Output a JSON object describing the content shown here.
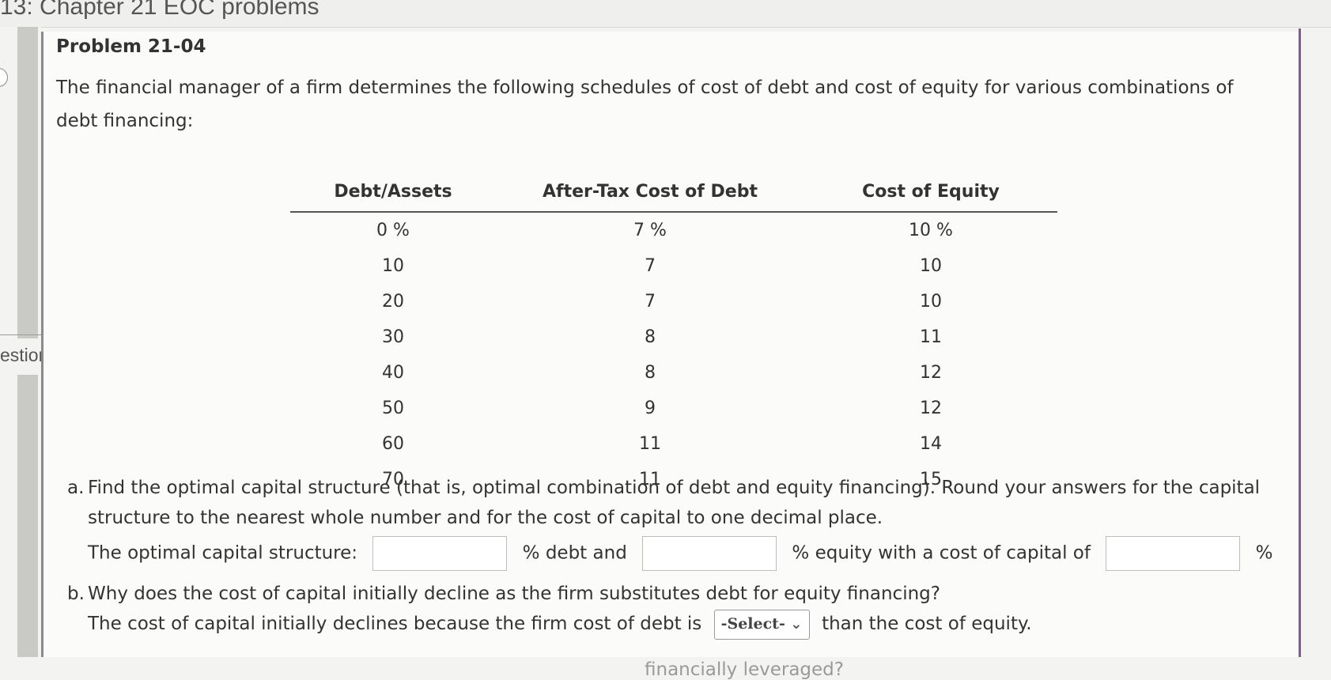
{
  "assignment": {
    "title": "13: Chapter 21 EOC problems"
  },
  "nav": {
    "label": "estions Navigation Menu"
  },
  "problem": {
    "title": "Problem 21-04",
    "intro": "The financial manager of a firm determines the following schedules of cost of debt and cost of equity for various combinations of debt financing:"
  },
  "schedule": {
    "headers": [
      "Debt/Assets",
      "After-Tax Cost of Debt",
      "Cost of Equity"
    ],
    "rows": [
      [
        "0 %",
        "7 %",
        "10 %"
      ],
      [
        "10",
        "7",
        "10"
      ],
      [
        "20",
        "7",
        "10"
      ],
      [
        "30",
        "8",
        "11"
      ],
      [
        "40",
        "8",
        "12"
      ],
      [
        "50",
        "9",
        "12"
      ],
      [
        "60",
        "11",
        "14"
      ],
      [
        "70",
        "11",
        "15"
      ]
    ]
  },
  "part_a": {
    "marker": "a.",
    "question_line1": "Find the optimal capital structure (that is, optimal combination of debt and equity financing). Round your answers for the capital",
    "question_line2": "structure to the nearest whole number and for the cost of capital to one decimal place.",
    "answer_label": "The optimal capital structure:",
    "debt_suffix": "% debt and",
    "equity_suffix": "% equity with a cost of capital of",
    "percent": "%"
  },
  "part_b": {
    "marker": "b.",
    "question": "Why does the cost of capital initially decline as the firm substitutes debt for equity financing?",
    "answer_prefix": "The cost of capital initially declines because the firm cost of debt is",
    "select_value": "-Select-",
    "answer_suffix": "than the cost of equity."
  },
  "cutoff": {
    "text": "financially leveraged?"
  }
}
